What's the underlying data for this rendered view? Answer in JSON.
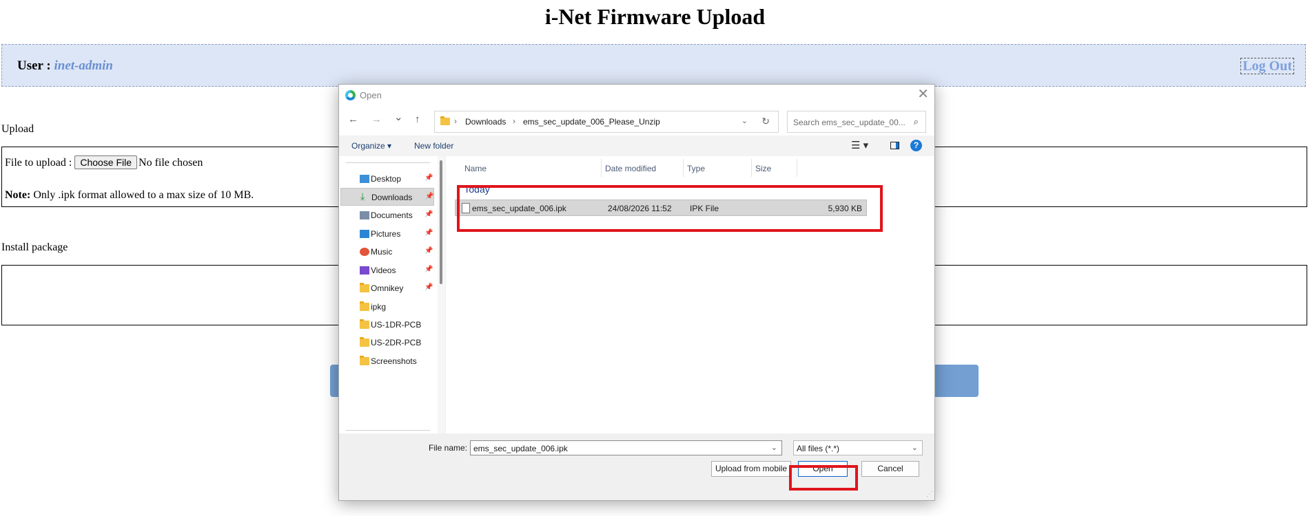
{
  "page": {
    "title": "i-Net Firmware Upload",
    "user_label": "User : ",
    "user_name": "inet-admin",
    "logout": "Log Out",
    "upload_section": "Upload",
    "file_to_upload": "File to upload :",
    "choose_file": "Choose File",
    "no_file": "No file chosen",
    "note_bold": "Note:",
    "note_text": " Only .ipk format allowed to a max size of 10 MB.",
    "install_section": "Install package"
  },
  "dialog": {
    "title": "Open",
    "close": "✕",
    "nav": {
      "back": "←",
      "forward": "→",
      "recent": "⌄",
      "up": "↑",
      "refresh": "↻"
    },
    "breadcrumb": [
      "Downloads",
      "ems_sec_update_006_Please_Unzip"
    ],
    "breadcrumb_sep": "›",
    "search_placeholder": "Search ems_sec_update_00...",
    "toolbar": {
      "organize": "Organize ▾",
      "new_folder": "New folder",
      "view": "☰ ▾",
      "help": "?"
    },
    "nav_items": [
      {
        "label": "Desktop",
        "icon": "desktop-icon",
        "pinned": true
      },
      {
        "label": "Downloads",
        "icon": "download-icon",
        "pinned": true,
        "selected": true
      },
      {
        "label": "Documents",
        "icon": "documents-icon",
        "pinned": true
      },
      {
        "label": "Pictures",
        "icon": "pictures-icon",
        "pinned": true
      },
      {
        "label": "Music",
        "icon": "music-icon",
        "pinned": true
      },
      {
        "label": "Videos",
        "icon": "videos-icon",
        "pinned": true
      },
      {
        "label": "Omnikey",
        "icon": "folder-icon",
        "pinned": true
      },
      {
        "label": "ipkg",
        "icon": "folder-icon",
        "pinned": false
      },
      {
        "label": "US-1DR-PCB",
        "icon": "folder-icon",
        "pinned": false
      },
      {
        "label": "US-2DR-PCB",
        "icon": "folder-icon",
        "pinned": false
      },
      {
        "label": "Screenshots",
        "icon": "folder-icon",
        "pinned": false
      }
    ],
    "columns": {
      "name": "Name",
      "date": "Date modified",
      "type": "Type",
      "size": "Size"
    },
    "group": "Today",
    "files": [
      {
        "name": "ems_sec_update_006.ipk",
        "date": "24/08/2026 11:52",
        "type": "IPK File",
        "size": "5,930 KB"
      }
    ],
    "file_name_label": "File name:",
    "file_name_value": "ems_sec_update_006.ipk",
    "file_type": "All files (*.*)",
    "upload_mobile": "Upload from mobile",
    "open": "Open",
    "cancel": "Cancel"
  },
  "colors": {
    "accent_blue": "#739fd3",
    "highlight_red": "#e0141c",
    "user_bar": "#dde6f6"
  }
}
